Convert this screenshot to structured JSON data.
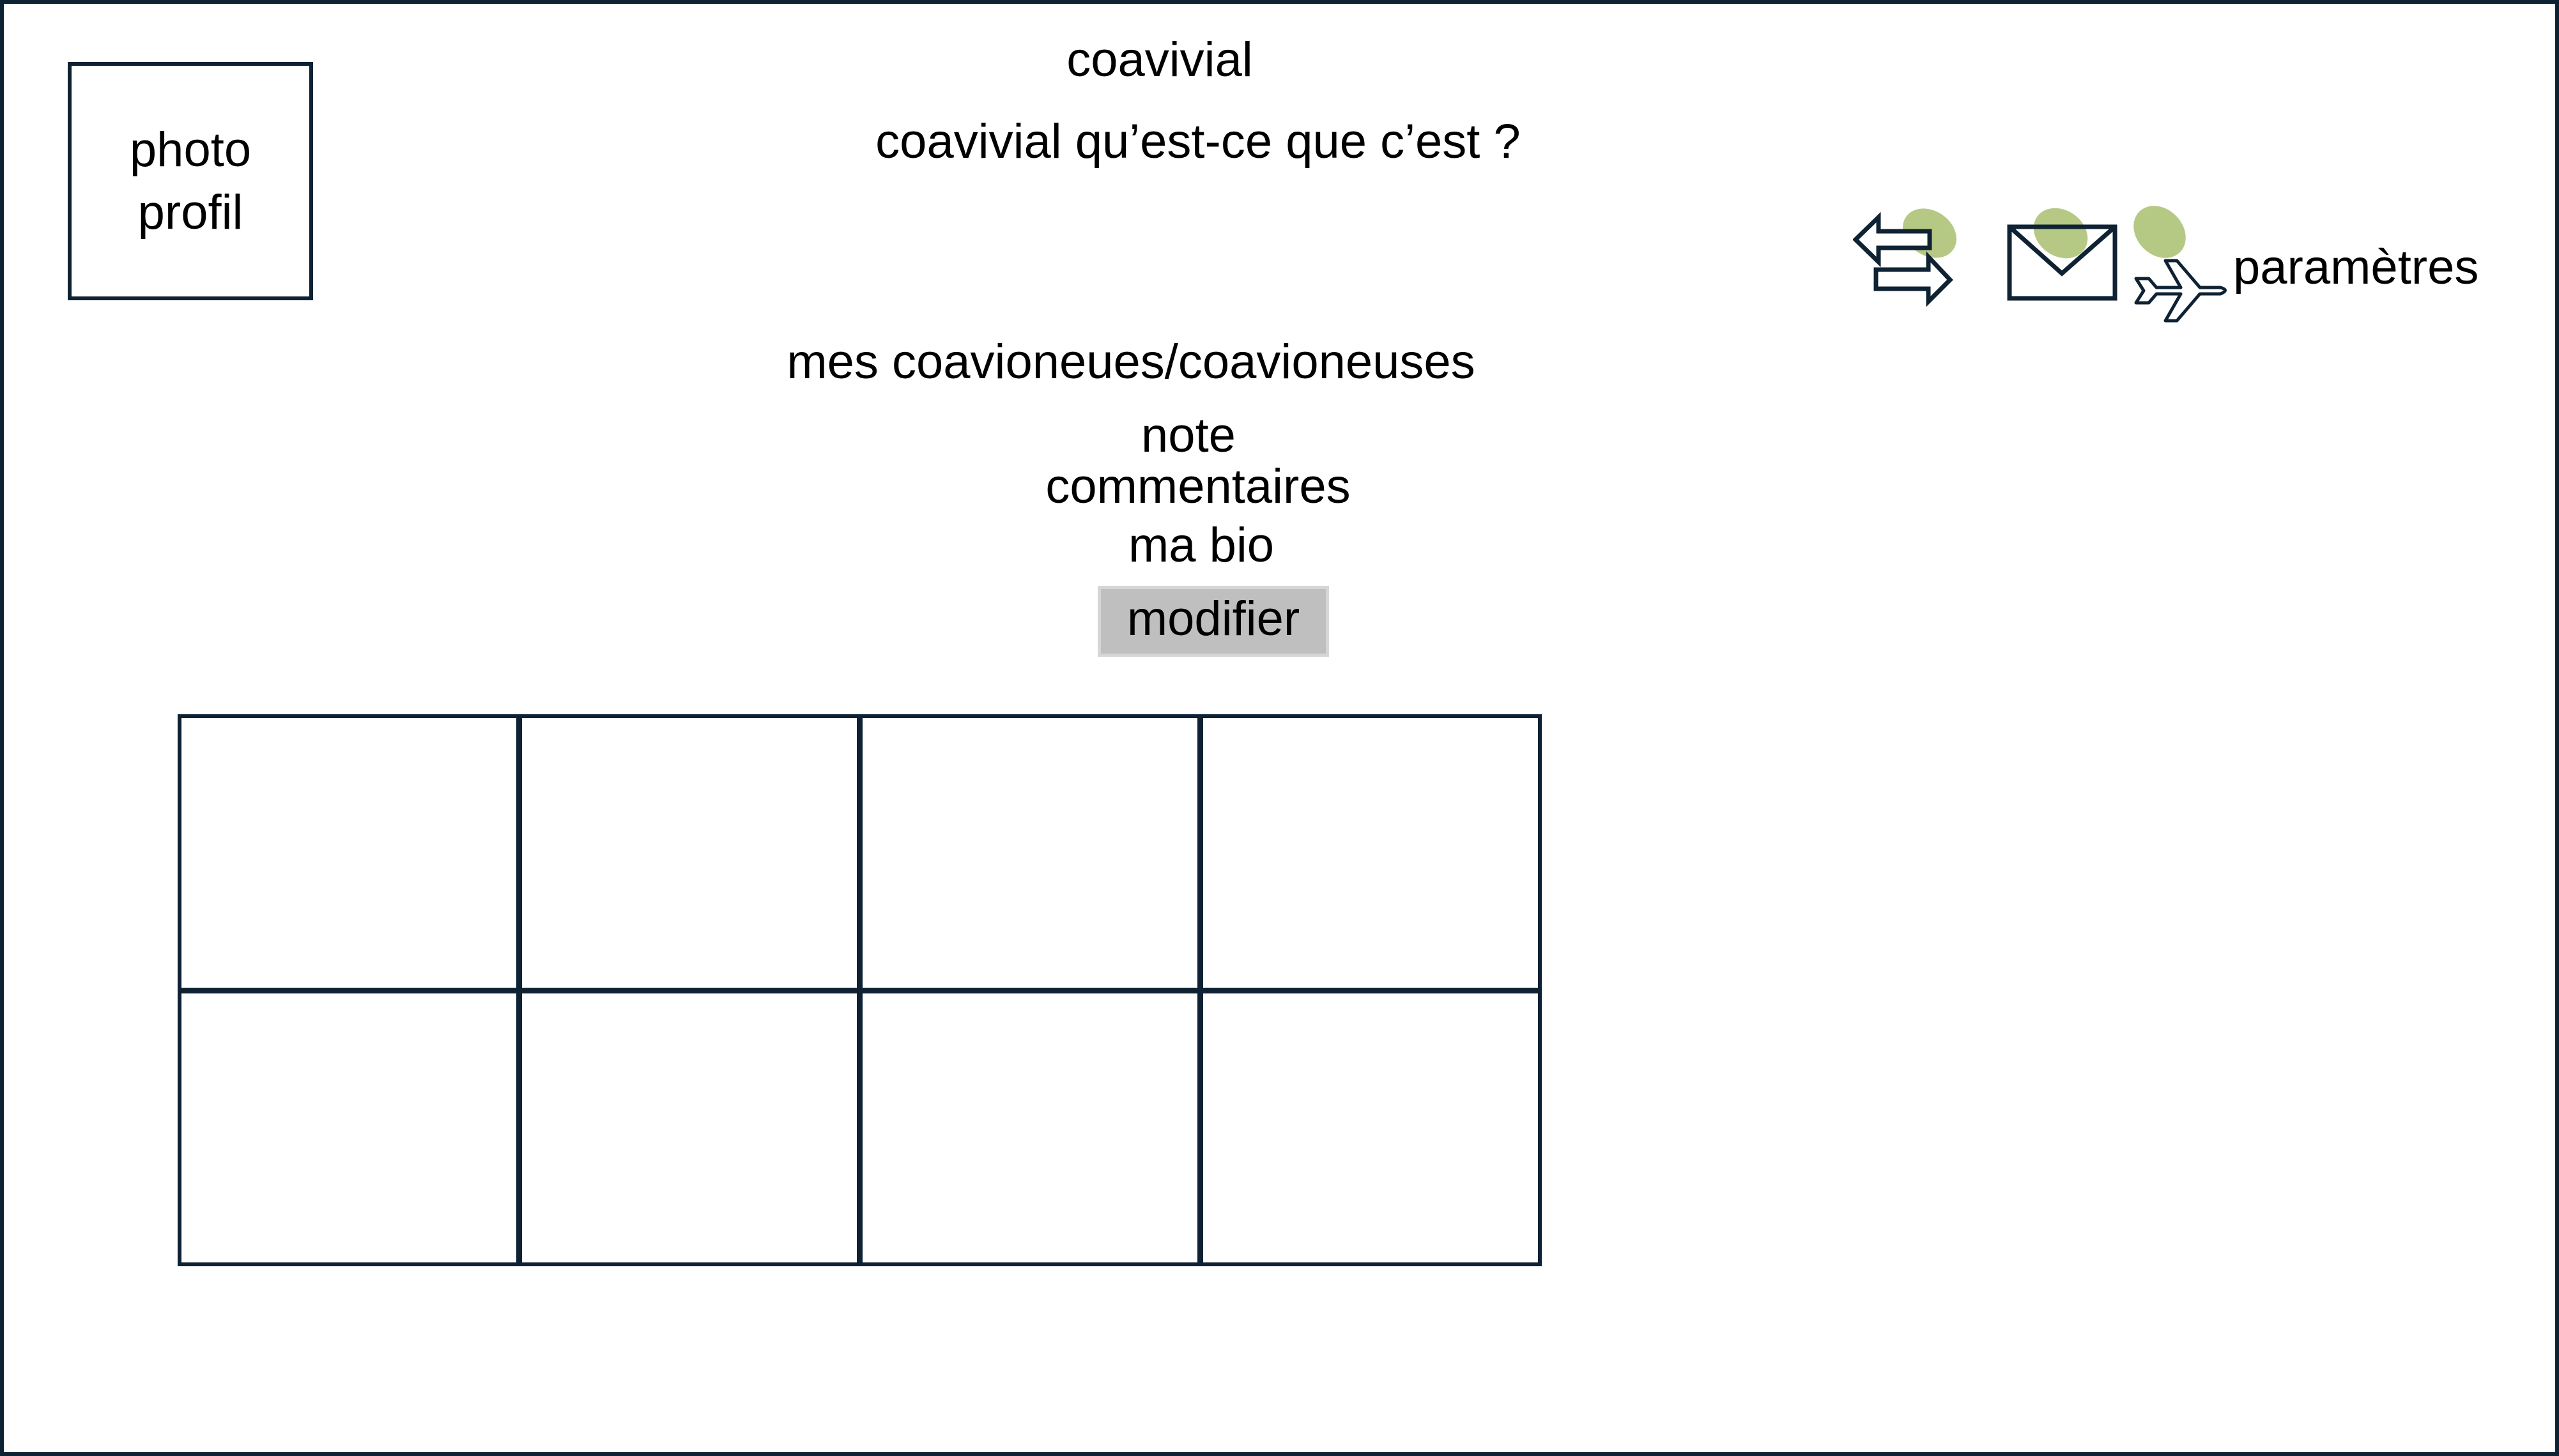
{
  "window": {
    "border_color": "#0e2233"
  },
  "profile": {
    "photo_label_line1": "photo",
    "photo_label_line2": "profil"
  },
  "header": {
    "title": "coavivial",
    "about_link": "coavivial qu’est-ce que c’est ?"
  },
  "toolbar": {
    "icons": [
      "swap-arrows-icon",
      "mail-icon",
      "airplane-icon"
    ],
    "badge_color": "#a9bf6e",
    "settings_label": "paramètres"
  },
  "profile_sections": {
    "companions_label": "mes coavioneues/coavioneuses",
    "rating_label": "note",
    "comments_label": "commentaires",
    "bio_label": "ma bio",
    "modify_button_label": "modifier"
  },
  "gallery": {
    "rows": 2,
    "columns": 4,
    "cells": [
      "",
      "",
      "",
      "",
      "",
      "",
      "",
      ""
    ]
  }
}
